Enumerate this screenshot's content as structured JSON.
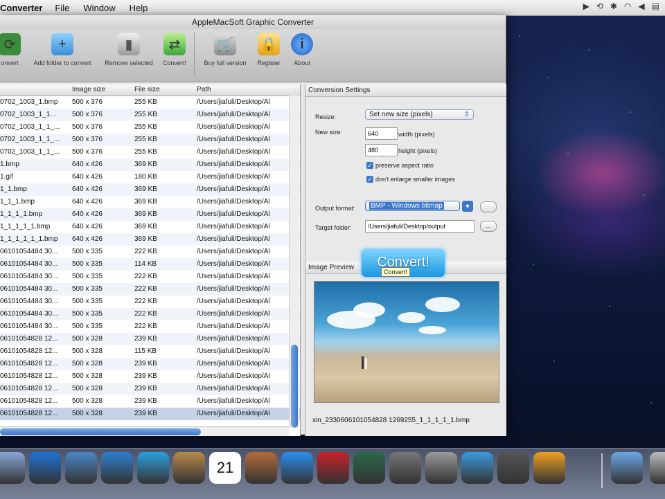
{
  "menubar": {
    "app": "Converter",
    "items": [
      "File",
      "Window",
      "Help"
    ]
  },
  "window": {
    "title": "AppleMacSoft Graphic Converter"
  },
  "toolbar": {
    "buttons": [
      {
        "label": "onvert",
        "icon": "convert-icon"
      },
      {
        "label": "Add folder to convert",
        "icon": "add-folder-icon"
      },
      {
        "label": "Remove selected",
        "icon": "trash-icon"
      },
      {
        "label": "Convert!",
        "icon": "convert-arrows-icon"
      },
      {
        "label": "Buy full version",
        "icon": "cart-icon"
      },
      {
        "label": "Register",
        "icon": "lock-icon"
      },
      {
        "label": "About",
        "icon": "info-icon"
      }
    ]
  },
  "table": {
    "headers": [
      "",
      "Image size",
      "File size",
      "Path"
    ],
    "rows": [
      [
        "0702_1003_1.bmp",
        "500 x 376",
        "255 KB",
        "/Users/jiafuli/Desktop/Al"
      ],
      [
        "0702_1003_1_1...",
        "500 x 376",
        "255 KB",
        "/Users/jiafuli/Desktop/Al"
      ],
      [
        "0702_1003_1_1_...",
        "500 x 376",
        "255 KB",
        "/Users/jiafuli/Desktop/Al"
      ],
      [
        "0702_1003_1_1_...",
        "500 x 376",
        "255 KB",
        "/Users/jiafuli/Desktop/Al"
      ],
      [
        "0702_1003_1_1_...",
        "500 x 376",
        "255 KB",
        "/Users/jiafuli/Desktop/Al"
      ],
      [
        "1.bmp",
        "640 x 426",
        "369 KB",
        "/Users/jiafuli/Desktop/Al"
      ],
      [
        "1.gif",
        "640 x 426",
        "180 KB",
        "/Users/jiafuli/Desktop/Al"
      ],
      [
        "1_1.bmp",
        "640 x 426",
        "369 KB",
        "/Users/jiafuli/Desktop/Al"
      ],
      [
        "1_1_1.bmp",
        "640 x 426",
        "369 KB",
        "/Users/jiafuli/Desktop/Al"
      ],
      [
        "1_1_1_1.bmp",
        "640 x 426",
        "369 KB",
        "/Users/jiafuli/Desktop/Al"
      ],
      [
        "1_1_1_1_1.bmp",
        "640 x 426",
        "369 KB",
        "/Users/jiafuli/Desktop/Al"
      ],
      [
        "1_1_1_1_1_1.bmp",
        "640 x 426",
        "369 KB",
        "/Users/jiafuli/Desktop/Al"
      ],
      [
        "06101054484 30...",
        "500 x 335",
        "222 KB",
        "/Users/jiafuli/Desktop/Al"
      ],
      [
        "06101054484 30...",
        "500 x 335",
        "114 KB",
        "/Users/jiafuli/Desktop/Al"
      ],
      [
        "06101054484 30...",
        "500 x 335",
        "222 KB",
        "/Users/jiafuli/Desktop/Al"
      ],
      [
        "06101054484 30...",
        "500 x 335",
        "222 KB",
        "/Users/jiafuli/Desktop/Al"
      ],
      [
        "06101054484 30...",
        "500 x 335",
        "222 KB",
        "/Users/jiafuli/Desktop/Al"
      ],
      [
        "06101054484 30...",
        "500 x 335",
        "222 KB",
        "/Users/jiafuli/Desktop/Al"
      ],
      [
        "06101054484 30...",
        "500 x 335",
        "222 KB",
        "/Users/jiafuli/Desktop/Al"
      ],
      [
        "06101054828 12...",
        "500 x 328",
        "239 KB",
        "/Users/jiafuli/Desktop/Al"
      ],
      [
        "06101054828 12...",
        "500 x 328",
        "115 KB",
        "/Users/jiafuli/Desktop/Al"
      ],
      [
        "06101054828 12...",
        "500 x 328",
        "239 KB",
        "/Users/jiafuli/Desktop/Al"
      ],
      [
        "06101054828 12...",
        "500 x 328",
        "239 KB",
        "/Users/jiafuli/Desktop/Al"
      ],
      [
        "06101054828 12...",
        "500 x 328",
        "239 KB",
        "/Users/jiafuli/Desktop/Al"
      ],
      [
        "06101054828 12...",
        "500 x 328",
        "239 KB",
        "/Users/jiafuli/Desktop/Al"
      ],
      [
        "06101054828 12...",
        "500 x 328",
        "239 KB",
        "/Users/jiafuli/Desktop/Al"
      ]
    ],
    "selected_row": 25
  },
  "settings": {
    "title": "Conversion Settings",
    "resize_label": "Resize:",
    "resize_value": "Set new size (pixels)",
    "new_size_label": "New size:",
    "width_value": "640",
    "width_label": "width  (pixels)",
    "height_value": "480",
    "height_label": "height  (pixels)",
    "aspect_label": "preserve aspect ratio",
    "enlarge_label": "don't enlarge smaller images",
    "output_format_label": "Output format:",
    "output_format_value": "BMP - Windows bitmap",
    "target_folder_label": "Target folder:",
    "target_folder_value": "/Users/jiafuli/Desktop/output",
    "browse_label": "..."
  },
  "preview": {
    "title": "Image Preview",
    "filename": "xin_2330606101054828 1269255_1_1_1_1_1.bmp"
  },
  "convert_button": {
    "label": "Convert!",
    "tooltip": "Convert!"
  },
  "dock": {
    "items": [
      "finder-icon",
      "app-store-icon",
      "preview-icon",
      "safari-icon",
      "facetime-icon",
      "address-book-icon",
      "calendar-icon",
      "iphoto-icon",
      "itunes-icon",
      "photo-booth-icon",
      "time-machine-icon",
      "system-preferences-icon",
      "installer-icon",
      "quicktime-icon",
      "imovie-icon",
      "converter-icon",
      "applications-folder-icon",
      "trash-icon"
    ],
    "calendar_day": "21"
  },
  "colors": {
    "accent": "#3d77c9",
    "convert": "#1a97e0"
  }
}
